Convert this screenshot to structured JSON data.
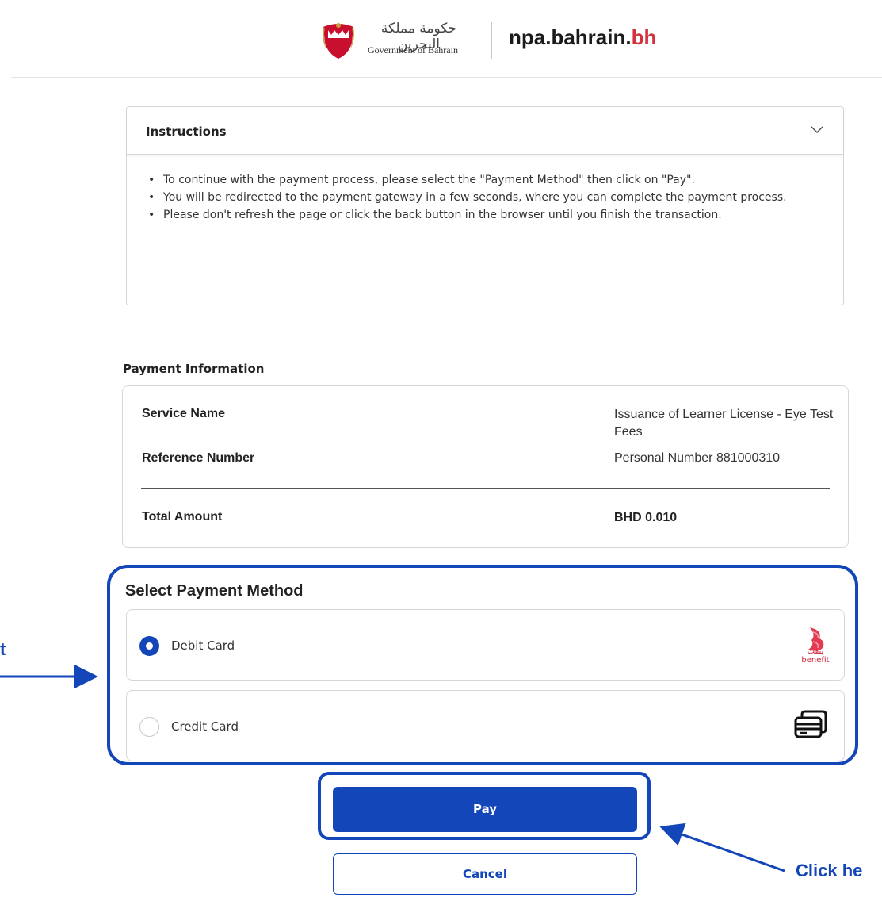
{
  "header": {
    "gov_arabic": "حكومة مملكة البحرين",
    "gov_english": "Government of Bahrain",
    "site_name": "npa.bahrain.",
    "site_tld": "bh"
  },
  "instructions": {
    "title": "Instructions",
    "items": [
      "To continue with the payment process, please select the \"Payment Method\" then click on \"Pay\".",
      "You will be redirected to the payment gateway in a few seconds, where you can complete the payment process.",
      "Please don't refresh the page or click the back button in the browser until you finish the transaction."
    ]
  },
  "payment_info": {
    "label": "Payment Information",
    "service_name_label": "Service Name",
    "service_name_value": "Issuance of Learner License - Eye Test Fees",
    "reference_label": "Reference Number",
    "reference_value": "Personal Number 881000310",
    "total_label": "Total Amount",
    "total_value": "BHD 0.010"
  },
  "payment_method": {
    "title": "Select Payment Method",
    "options": [
      {
        "label": "Debit Card",
        "selected": true,
        "logo_arabic": "بنفت",
        "logo_text": "benefit"
      },
      {
        "label": "Credit Card",
        "selected": false
      }
    ]
  },
  "actions": {
    "pay": "Pay",
    "cancel": "Cancel"
  },
  "annotations": {
    "left_text": "t",
    "right_text": "Click he"
  },
  "colors": {
    "accent": "#1346b8",
    "brand_red": "#d1323e"
  }
}
